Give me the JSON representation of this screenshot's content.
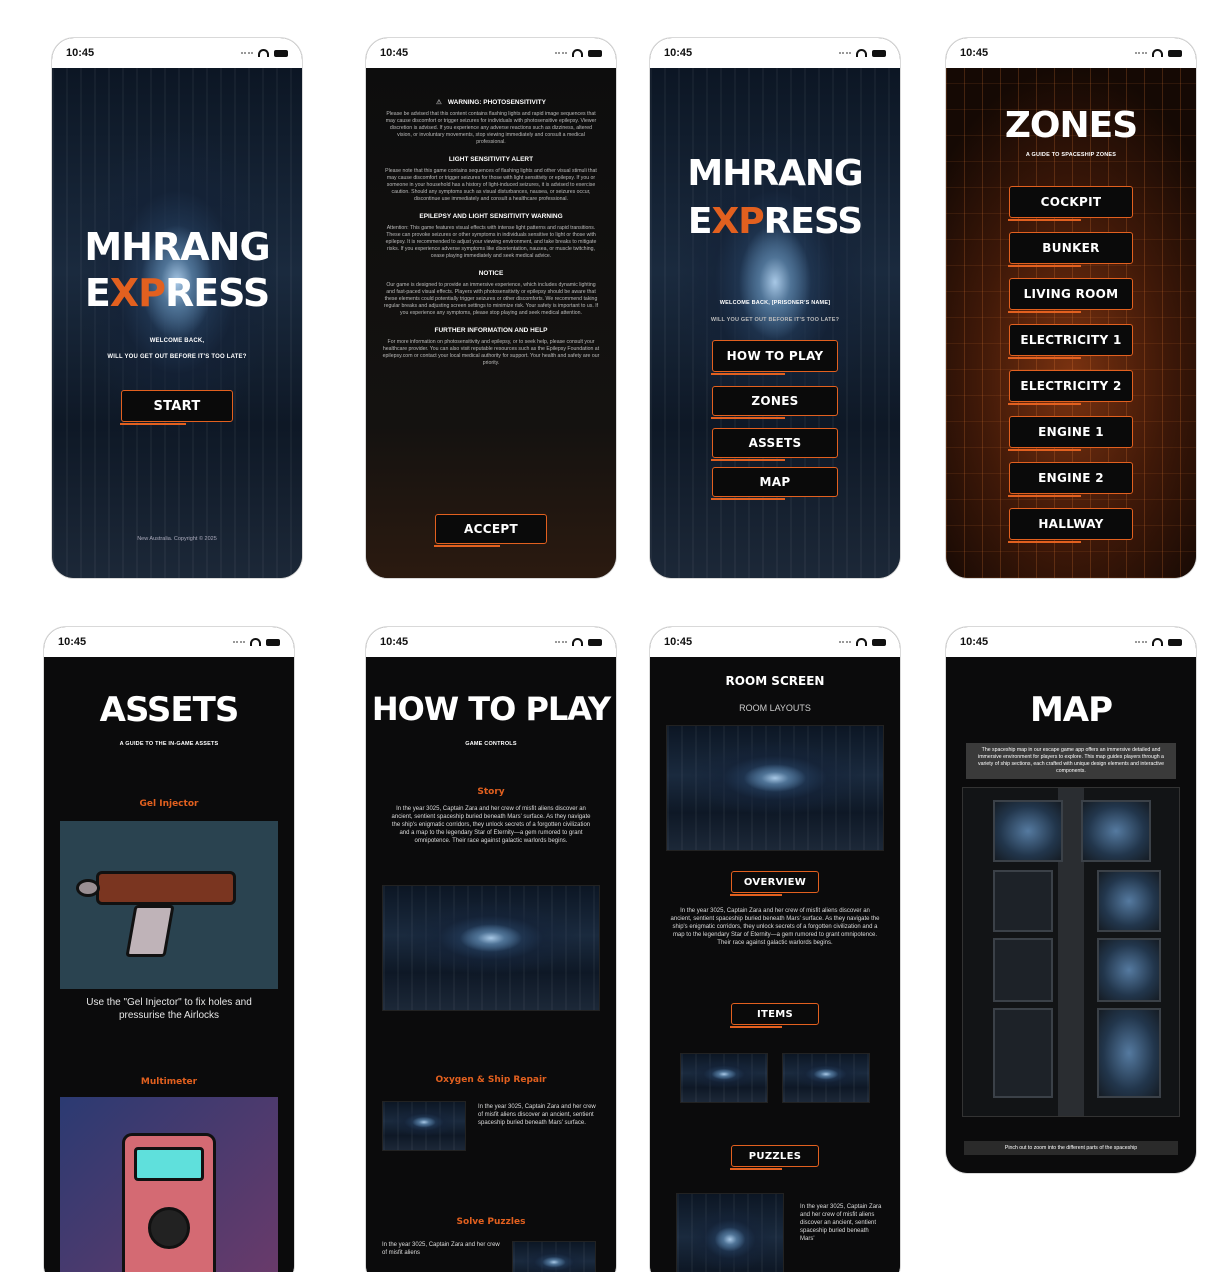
{
  "status_time": "10:45",
  "accent": "#e2601f",
  "screens": {
    "start": {
      "title_line1": "MHRANG",
      "title_e": "E",
      "title_xp": "XP",
      "title_rest": "RESS",
      "welcome": "WELCOME BACK,",
      "question": "WILL YOU GET OUT BEFORE IT'S TOO LATE?",
      "start_label": "START",
      "footer": "New Australia. Copyright © 2025"
    },
    "warning": {
      "h1": "WARNING: PHOTOSENSITIVITY",
      "p1": "Please be advised that this content contains flashing lights and rapid image sequences that may cause discomfort or trigger seizures for individuals with photosensitive epilepsy. Viewer discretion is advised. If you experience any adverse reactions such as dizziness, altered vision, or involuntary movements, stop viewing immediately and consult a medical professional.",
      "h2": "LIGHT SENSITIVITY ALERT",
      "p2": "Please note that this game contains sequences of flashing lights and other visual stimuli that may cause discomfort or trigger seizures for those with light sensitivity or epilepsy. If you or someone in your household has a history of light-induced seizures, it is advised to exercise caution. Should any symptoms such as visual disturbances, nausea, or seizures occur, discontinue use immediately and consult a healthcare professional.",
      "h3": "EPILEPSY AND LIGHT SENSITIVITY WARNING",
      "p3": "Attention: This game features visual effects with intense light patterns and rapid transitions. These can provoke seizures or other symptoms in individuals sensitive to light or those with epilepsy. It is recommended to adjust your viewing environment, and take breaks to mitigate risks. If you experience adverse symptoms like disorientation, nausea, or muscle twitching, cease playing immediately and seek medical advice.",
      "h4": "NOTICE",
      "p4": "Our game is designed to provide an immersive experience, which includes dynamic lighting and fast-paced visual effects. Players with photosensitivity or epilepsy should be aware that these elements could potentially trigger seizures or other discomforts. We recommend taking regular breaks and adjusting screen settings to minimize risk. Your safety is important to us. If you experience any symptoms, please stop playing and seek medical attention.",
      "h5": "FURTHER INFORMATION AND HELP",
      "p5": "For more information on photosensitivity and epilepsy, or to seek help, please consult your healthcare provider. You can also visit reputable resources such as the Epilepsy Foundation at epilepsy.com or contact your local medical authority for support. Your health and safety are our priority.",
      "accept_label": "ACCEPT"
    },
    "menu": {
      "title_line1": "MHRANG",
      "title_e": "E",
      "title_xp": "XP",
      "title_rest": "RESS",
      "welcome": "WELCOME BACK, [PRISONER'S NAME]",
      "question": "WILL YOU GET OUT BEFORE IT'S TOO LATE?",
      "buttons": [
        "HOW TO PLAY",
        "ZONES",
        "ASSETS",
        "MAP"
      ]
    },
    "zones": {
      "title": "ZONES",
      "subtitle": "A GUIDE TO SPACESHIP ZONES",
      "items": [
        "COCKPIT",
        "BUNKER",
        "LIVING ROOM",
        "ELECTRICITY 1",
        "ELECTRICITY 2",
        "ENGINE 1",
        "ENGINE 2",
        "HALLWAY"
      ]
    },
    "assets": {
      "title": "ASSETS",
      "subtitle": "A GUIDE TO THE IN-GAME ASSETS",
      "item1_name": "Gel Injector",
      "item1_desc": "Use the \"Gel Injector\" to fix holes and pressurise the Airlocks",
      "item2_name": "Multimeter"
    },
    "howto": {
      "title": "HOW TO PLAY",
      "subtitle": "GAME CONTROLS",
      "story_h": "Story",
      "story_p": "In the year 3025, Captain Zara and her crew of misfit aliens discover an ancient, sentient spaceship buried beneath Mars' surface. As they navigate the ship's enigmatic corridors, they unlock secrets of a forgotten civilization and a map to the legendary Star of Eternity—a gem rumored to grant omnipotence. Their race against galactic warlords begins.",
      "oxygen_h": "Oxygen & Ship Repair",
      "oxygen_p": "In the year 3025, Captain Zara and her crew of misfit aliens discover an ancient, sentient spaceship buried beneath Mars' surface.",
      "puzzles_h": "Solve Puzzles",
      "puzzles_p": "In the year 3025, Captain Zara and her crew of misfit aliens"
    },
    "room": {
      "title": "ROOM SCREEN",
      "subtitle": "ROOM LAYOUTS",
      "overview_label": "OVERVIEW",
      "overview_p": "In the year 3025, Captain Zara and her crew of misfit aliens discover an ancient, sentient spaceship buried beneath Mars' surface. As they navigate the ship's enigmatic corridors, they unlock secrets of a forgotten civilization and a map to the legendary Star of Eternity—a gem rumored to grant omnipotence. Their race against galactic warlords begins.",
      "items_label": "ITEMS",
      "puzzles_label": "PUZZLES",
      "puzzles_p": "In the year 3025, Captain Zara and her crew of misfit aliens discover an ancient, sentient spaceship buried beneath Mars'"
    },
    "map": {
      "title": "MAP",
      "desc": "The spaceship map in our escape game app offers an immersive detailed and immersive environment for players to explore. This map guides players through a variety of ship sections, each crafted with unique design elements and interactive components.",
      "hint": "Pinch out to zoom into the different parts of the spaceship"
    }
  }
}
